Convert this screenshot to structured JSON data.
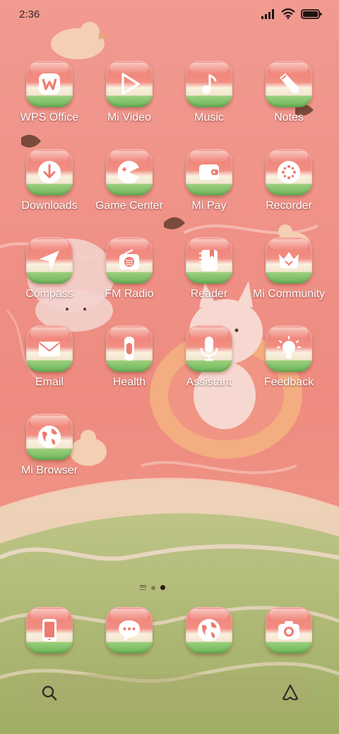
{
  "status_bar": {
    "time": "2:36",
    "icons": [
      "signal-icon",
      "wifi-icon",
      "battery-icon"
    ],
    "battery_level": 1.0
  },
  "apps": [
    {
      "label": "WPS Office",
      "icon": "wps-office-icon"
    },
    {
      "label": "Mi Video",
      "icon": "play-icon"
    },
    {
      "label": "Music",
      "icon": "music-note-icon"
    },
    {
      "label": "Notes",
      "icon": "pencil-icon"
    },
    {
      "label": "Downloads",
      "icon": "download-icon"
    },
    {
      "label": "Game Center",
      "icon": "game-center-icon"
    },
    {
      "label": "Mi Pay",
      "icon": "wallet-icon"
    },
    {
      "label": "Recorder",
      "icon": "recorder-icon"
    },
    {
      "label": "Compass",
      "icon": "compass-icon"
    },
    {
      "label": "FM Radio",
      "icon": "radio-icon"
    },
    {
      "label": "Reader",
      "icon": "book-icon"
    },
    {
      "label": "Mi Community",
      "icon": "crown-icon"
    },
    {
      "label": "Email",
      "icon": "envelope-icon"
    },
    {
      "label": "Health",
      "icon": "watch-icon"
    },
    {
      "label": "Assistant",
      "icon": "microphone-icon"
    },
    {
      "label": "Feedback",
      "icon": "lightbulb-icon"
    },
    {
      "label": "Mi Browser",
      "icon": "globe-icon"
    }
  ],
  "page_indicator": {
    "pages": 2,
    "active_page": 2
  },
  "dock": [
    {
      "name": "Phone",
      "icon": "phone-device-icon"
    },
    {
      "name": "Messages",
      "icon": "chat-bubble-icon"
    },
    {
      "name": "Browser",
      "icon": "globe-icon"
    },
    {
      "name": "Camera",
      "icon": "camera-icon"
    }
  ],
  "search_bar": {
    "placeholder": "",
    "left_icon": "search-icon",
    "right_icon": "assistant-triangle-icon"
  },
  "colors": {
    "wallpaper_red": "#ef8f86",
    "wallpaper_green": "#a9b36c",
    "icon_top": "#ef7d70",
    "icon_rind_white": "#faf0df",
    "icon_rind_green": "#6bb45a",
    "label": "#ffffff"
  }
}
